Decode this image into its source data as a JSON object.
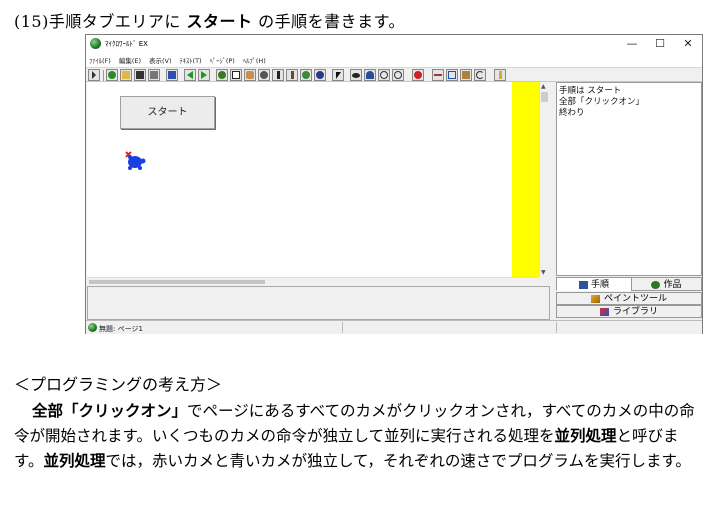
{
  "heading": {
    "prefix": "(15)手順タブエリアに",
    "bold": "スタート",
    "suffix": "の手順を書きます。"
  },
  "window": {
    "title": "ﾏｲｸﾛﾜｰﾙﾄﾞ EX",
    "controls": {
      "minimize": "—",
      "maximize": "☐",
      "close": "✕"
    },
    "menu": [
      "ﾌｧｲﾙ(F)",
      "編集(E)",
      "表示(V)",
      "ﾃｷｽﾄ(T)",
      "ﾍﾟｰｼﾞ(P)",
      "ﾍﾙﾌﾟ(H)"
    ],
    "toolbar_icons": [
      "pointer-tool-icon",
      "globe-icon",
      "open-folder-icon",
      "save-icon",
      "print-icon",
      "book-icon",
      "left-arrow-icon",
      "right-arrow-icon",
      "turtle-icon",
      "text-icon",
      "hand-icon",
      "eye-icon",
      "music-icon",
      "pen-icon",
      "palette-icon",
      "ball-icon",
      "cursor-icon",
      "view-icon",
      "person-icon",
      "zoom-in-icon",
      "zoom-out-icon",
      "stop-icon",
      "cut-icon",
      "copy-icon",
      "paste-icon",
      "undo-icon",
      "help-icon"
    ],
    "start_button": "スタート",
    "procedure_text": "手順は スタート\n全部「クリックオン」\n終わり",
    "tabs": {
      "procedure": "手順",
      "works": "作品"
    },
    "paint_tool": "ペイントツール",
    "library": "ライブラリ",
    "status": "無題: ページ1",
    "colors": {
      "panel_yellow": "#ffff00",
      "turtle": "#1a3fe0",
      "turtle_mark": "#e02020"
    }
  },
  "section_title": "＜プログラミングの考え方＞",
  "paragraph": {
    "p1_bold": "全部「クリックオン」",
    "p1_text": "でページにあるすべてのカメがクリックオンされ，すべてのカメの中の命令が開始されます。いくつものカメの命令が独立して並列に実行される処理を",
    "p2_bold": "並列処理",
    "p2_text": "と呼びます。",
    "p3_bold": "並列処理",
    "p3_text": "では，赤いカメと青いカメが独立して，それぞれの速さでプログラムを実行します。"
  }
}
